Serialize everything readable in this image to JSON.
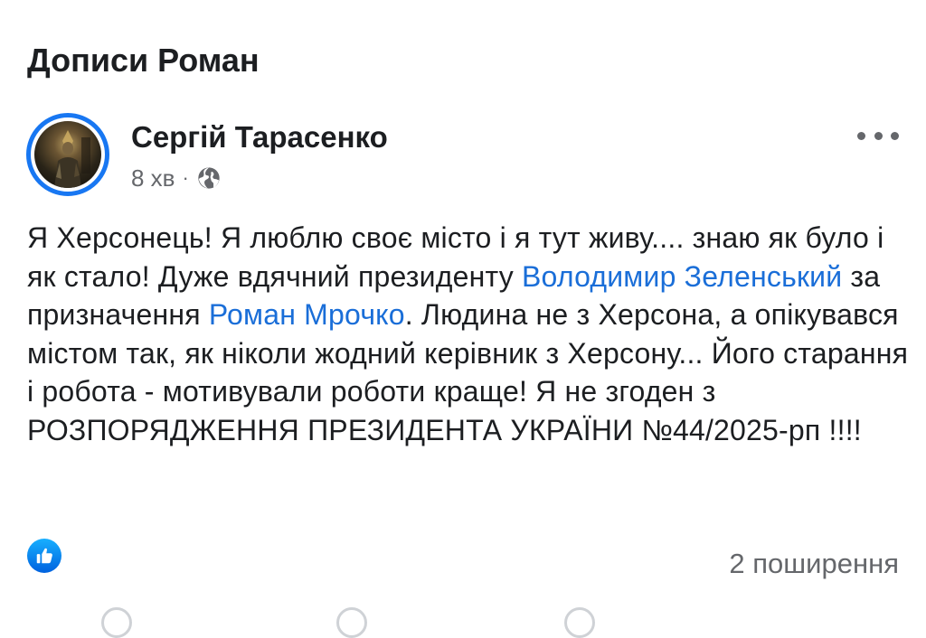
{
  "section": {
    "title": "Дописи Роман"
  },
  "post": {
    "author": "Сергій Тарасенко",
    "time": "8 хв",
    "separator": "·",
    "privacy_icon": "globe-icon",
    "more_icon": "more-horizontal-icon",
    "text_segments": [
      {
        "type": "text",
        "value": "Я Херсонець! Я люблю своє місто і я тут живу.... знаю як було і як стало! Дуже вдячний президенту "
      },
      {
        "type": "link",
        "value": "Володимир Зеленський"
      },
      {
        "type": "text",
        "value": " за призначення "
      },
      {
        "type": "link",
        "value": "Роман Мрочко"
      },
      {
        "type": "text",
        "value": ". Людина не з Херсона, а опікувався містом так, як ніколи жодний керівник з Херсону... Його старання і робота - мотивували роботи краще! Я не згоден з РОЗПОРЯДЖЕННЯ ПРЕЗИДЕНТА УКРАЇНИ №44/2025-рп !!!!"
      }
    ],
    "reaction_icon": "like-reaction-icon",
    "shares": "2 поширення"
  },
  "colors": {
    "accent": "#1877f2",
    "link": "#1a6ed8",
    "secondary_text": "#65676b",
    "primary_text": "#1c1e21"
  }
}
